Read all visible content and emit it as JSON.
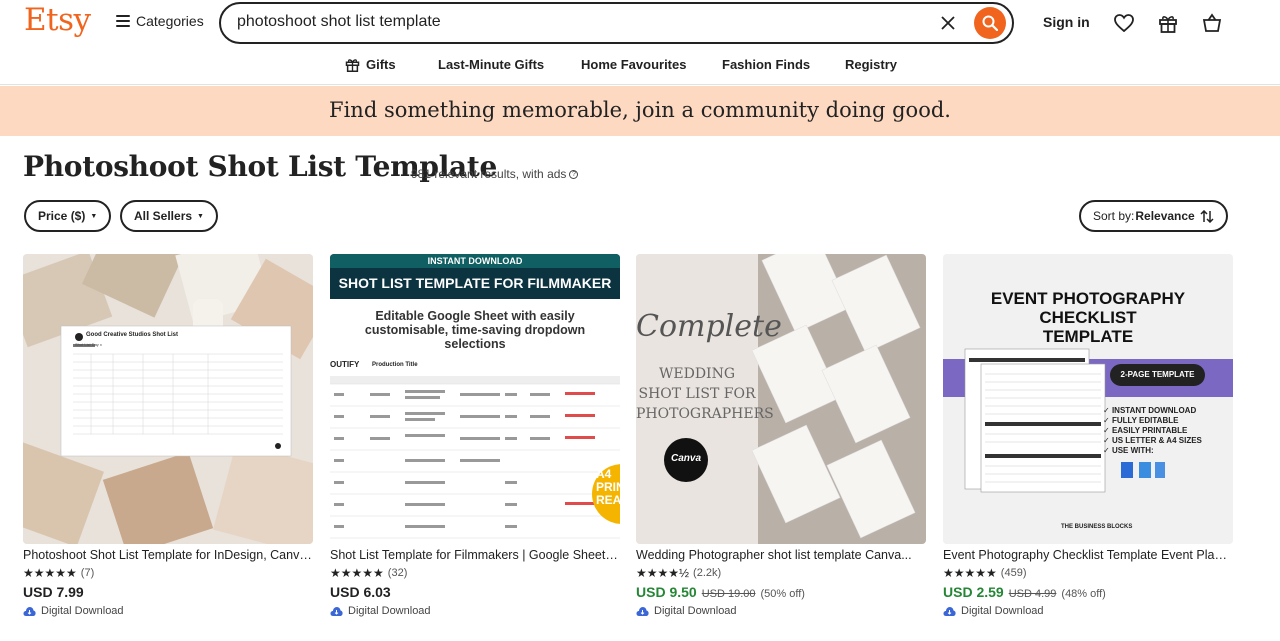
{
  "header": {
    "logo": "Etsy",
    "categories_label": "Categories",
    "search_value": "photoshoot shot list template",
    "signin_label": "Sign in"
  },
  "subnav": {
    "items": [
      "Gifts",
      "Last-Minute Gifts",
      "Home Favourites",
      "Fashion Finds",
      "Registry"
    ]
  },
  "banner": {
    "text": "Find something memorable, join a community doing good."
  },
  "page": {
    "title": "Photoshoot Shot List Template",
    "results": "981 relevant results, with ads",
    "results_icon": "?"
  },
  "filters": {
    "price": "Price ($)",
    "sellers": "All Sellers",
    "sort_prefix": "Sort by: ",
    "sort_value": "Relevance"
  },
  "listings": [
    {
      "title": "Photoshoot Shot List Template for InDesign, Canva...",
      "stars": "★★★★★",
      "reviews": "(7)",
      "price": "USD 7.99",
      "original_price": "",
      "discount": "",
      "badge": "Digital Download",
      "image_text": {
        "heading": "Good Creative Studios Shot List",
        "sub": "Shot List Day x"
      }
    },
    {
      "title": "Shot List Template for Filmmakers | Google Sheets...",
      "stars": "★★★★★",
      "reviews": "(32)",
      "price": "USD 6.03",
      "original_price": "",
      "discount": "",
      "badge": "Digital Download",
      "image_text": {
        "tag": "INSTANT DOWNLOAD",
        "heading": "SHOT LIST TEMPLATE FOR FILMMAKER",
        "sub": "Editable Google Sheet with easily customisable, time-saving dropdown selections",
        "brand": "OUTIFY",
        "table_title": "Production Title",
        "corner": "A4 PRINT READY"
      }
    },
    {
      "title": "Wedding Photographer shot list template Canva...",
      "stars": "★★★★½",
      "reviews": "(2.2k)",
      "price": "USD 9.50",
      "original_price": "USD 19.00",
      "discount": "(50% off)",
      "badge": "Digital Download",
      "image_text": {
        "script": "Complete",
        "heading": "WEDDING SHOT LIST FOR PHOTOGRAPHERS",
        "badge": "Canva"
      }
    },
    {
      "title": "Event Photography Checklist Template Event Planner...",
      "stars": "★★★★★",
      "reviews": "(459)",
      "price": "USD 2.59",
      "original_price": "USD 4.99",
      "discount": "(48% off)",
      "badge": "Digital Download",
      "image_text": {
        "heading1": "EVENT PHOTOGRAPHY",
        "heading2": "CHECKLIST",
        "heading3": "TEMPLATE",
        "pill": "2-PAGE TEMPLATE",
        "features": [
          "INSTANT DOWNLOAD",
          "FULLY EDITABLE",
          "EASILY PRINTABLE",
          "US LETTER & A4 SIZES",
          "USE WITH:"
        ],
        "brand": "THE BUSINESS BLOCKS"
      }
    }
  ],
  "colors": {
    "brand": "#f1641e",
    "banner": "#fdd9c2",
    "sale": "#258635"
  }
}
